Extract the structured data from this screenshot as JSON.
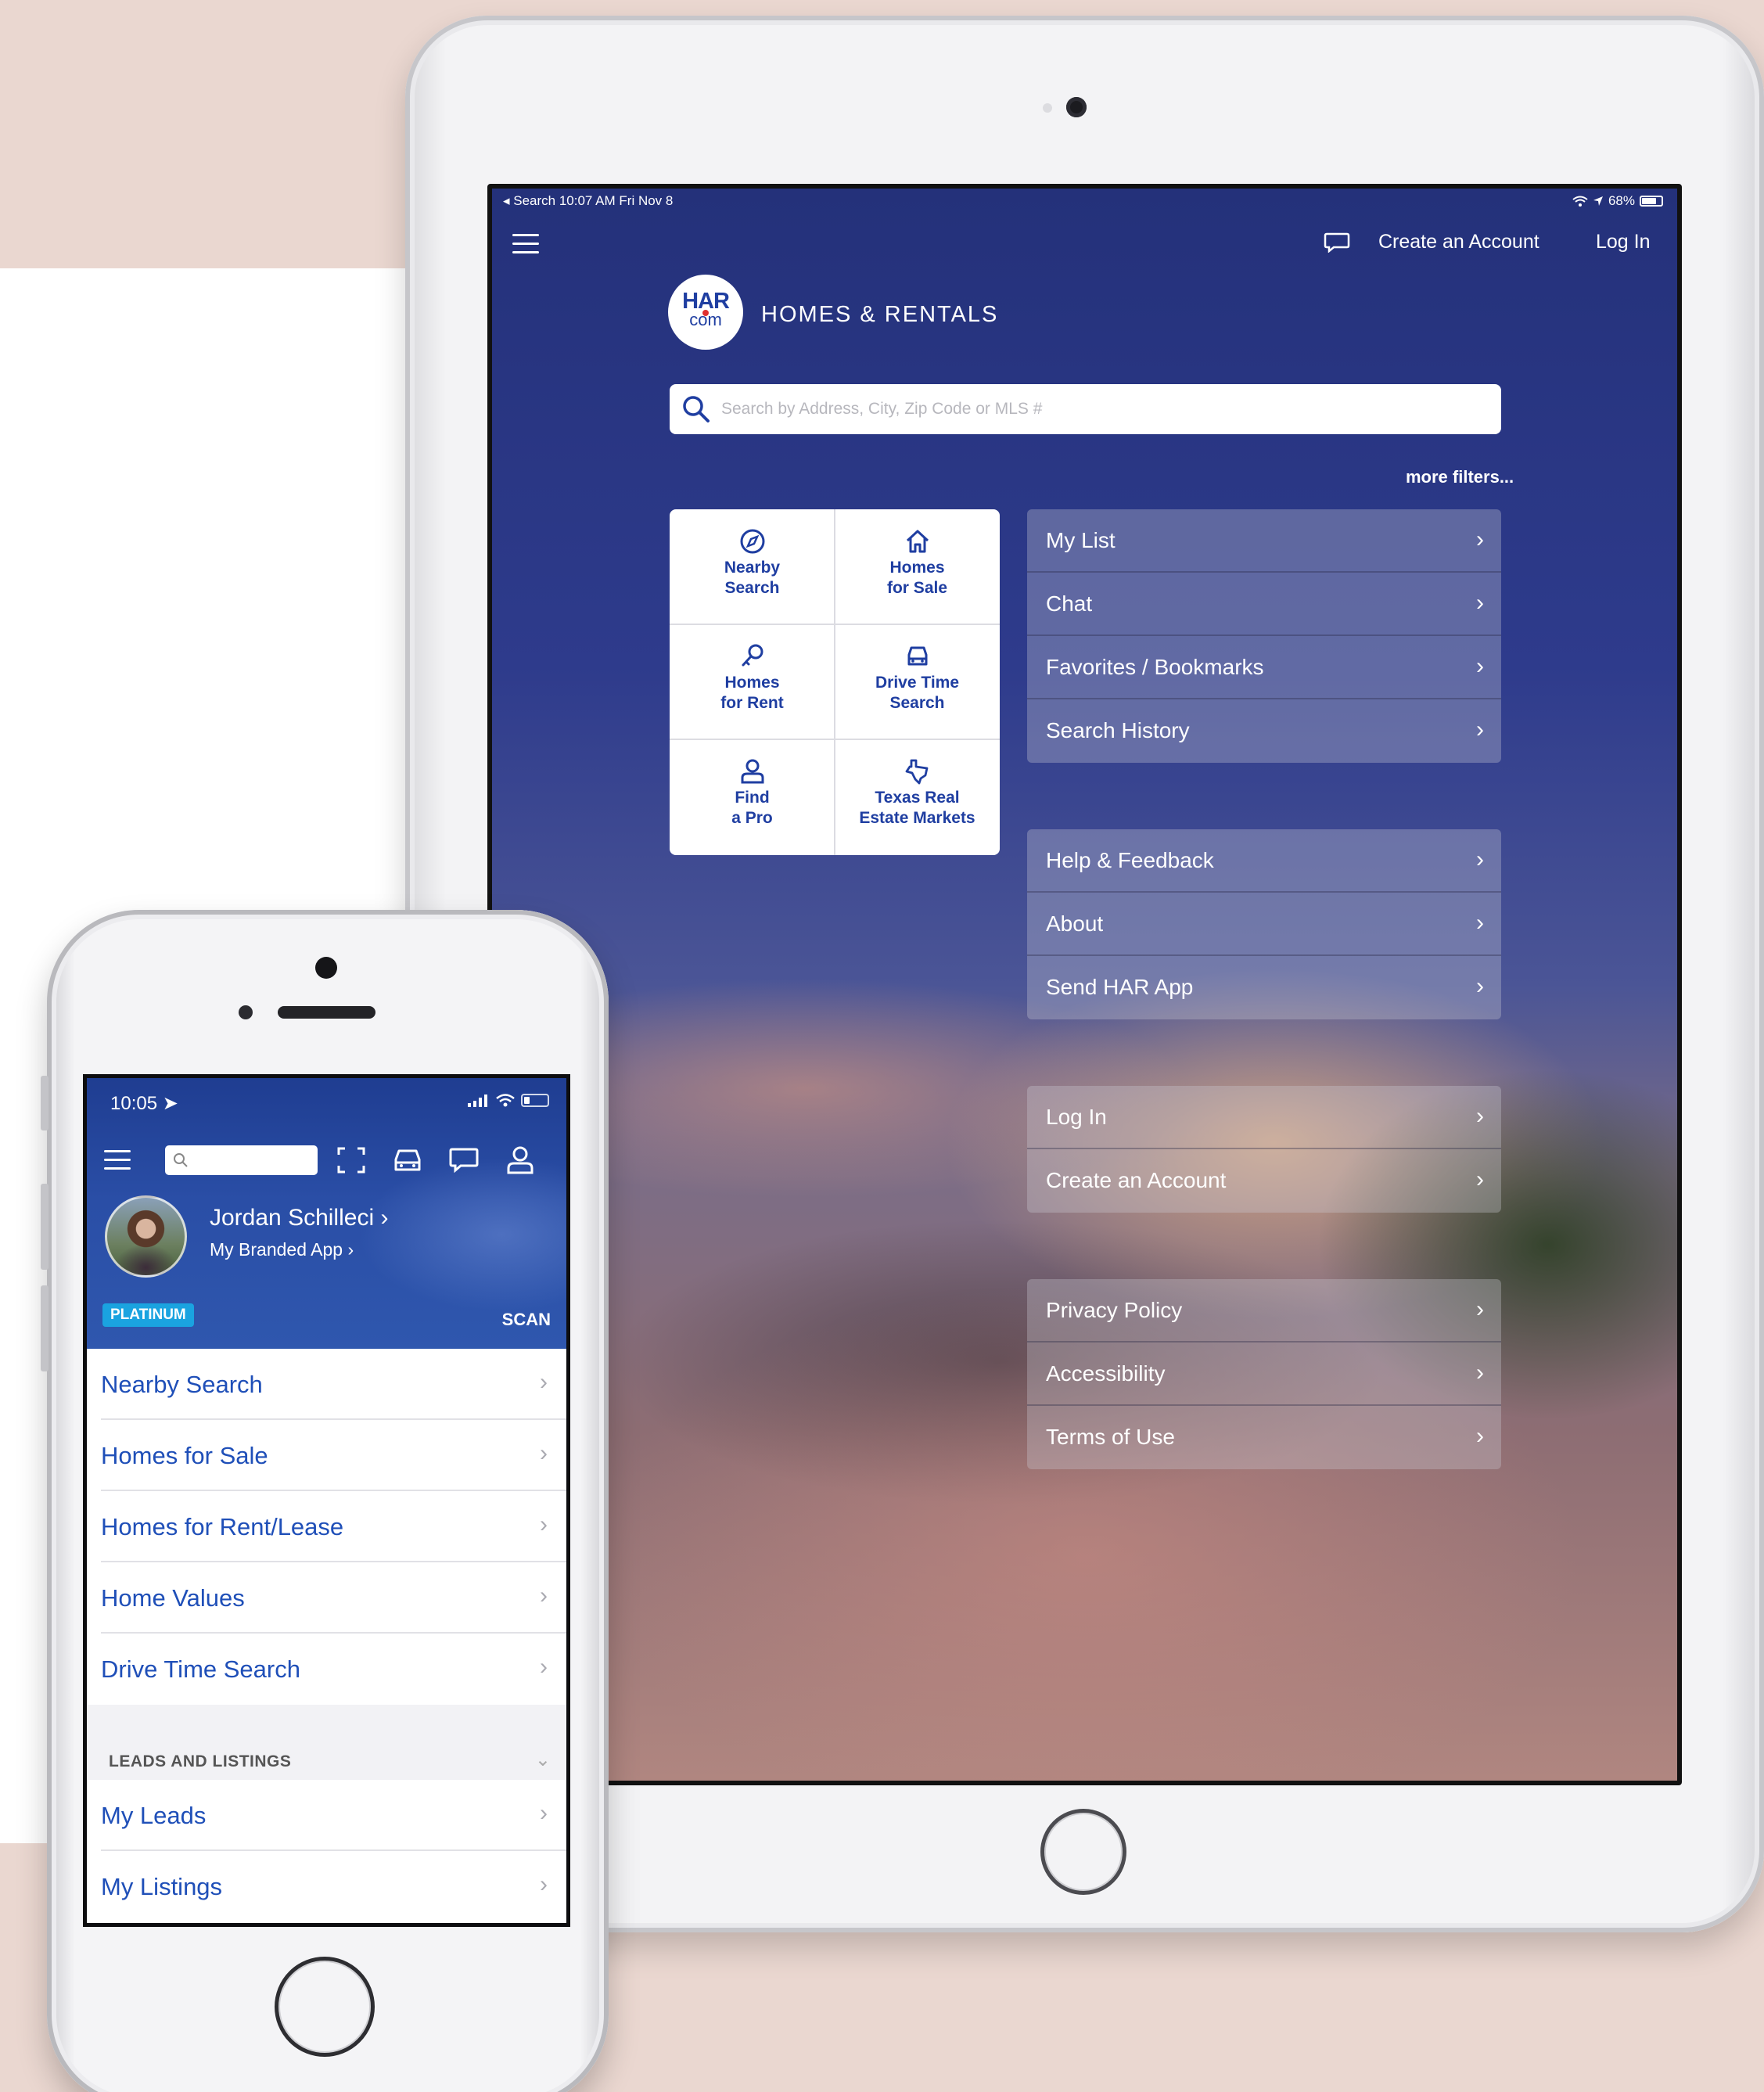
{
  "ipad": {
    "status": {
      "left": "◂ Search   10:07 AM   Fri Nov 8",
      "battery": "68%"
    },
    "topbar": {
      "create_account": "Create an Account",
      "login": "Log In",
      "menu_icon": "hamburger-icon",
      "chat_icon": "chat-icon"
    },
    "brand": {
      "logo_har": "HAR",
      "logo_com": "com",
      "title": "HOMES & RENTALS"
    },
    "search": {
      "placeholder": "Search by Address, City, Zip Code or MLS #",
      "more_filters": "more filters..."
    },
    "tiles": [
      {
        "line1": "Nearby",
        "line2": "Search",
        "icon": "compass-icon"
      },
      {
        "line1": "Homes",
        "line2": "for Sale",
        "icon": "house-icon"
      },
      {
        "line1": "Homes",
        "line2": "for Rent",
        "icon": "key-icon"
      },
      {
        "line1": "Drive Time",
        "line2": "Search",
        "icon": "car-icon"
      },
      {
        "line1": "Find",
        "line2": "a Pro",
        "icon": "person-icon"
      },
      {
        "line1": "Texas Real",
        "line2": "Estate Markets",
        "icon": "texas-icon"
      }
    ],
    "menu_groups": [
      [
        "My List",
        "Chat",
        "Favorites / Bookmarks",
        "Search History"
      ],
      [
        "Help & Feedback",
        "About",
        "Send HAR App"
      ],
      [
        "Log In",
        "Create an Account"
      ],
      [
        "Privacy Policy",
        "Accessibility",
        "Terms of Use"
      ]
    ]
  },
  "iphone": {
    "status": {
      "time": "10:05"
    },
    "profile": {
      "name": "Jordan Schilleci",
      "subtitle": "My Branded App",
      "badge": "PLATINUM",
      "scan": "SCAN"
    },
    "menu": [
      "Nearby Search",
      "Homes for Sale",
      "Homes for Rent/Lease",
      "Home Values",
      "Drive Time Search"
    ],
    "section": {
      "title": "LEADS AND LISTINGS"
    },
    "menu2": [
      "My Leads",
      "My Listings"
    ]
  },
  "colors": {
    "accent": "#1f3ea1",
    "link": "#1f4fb8",
    "badge": "#1aa3e0"
  }
}
